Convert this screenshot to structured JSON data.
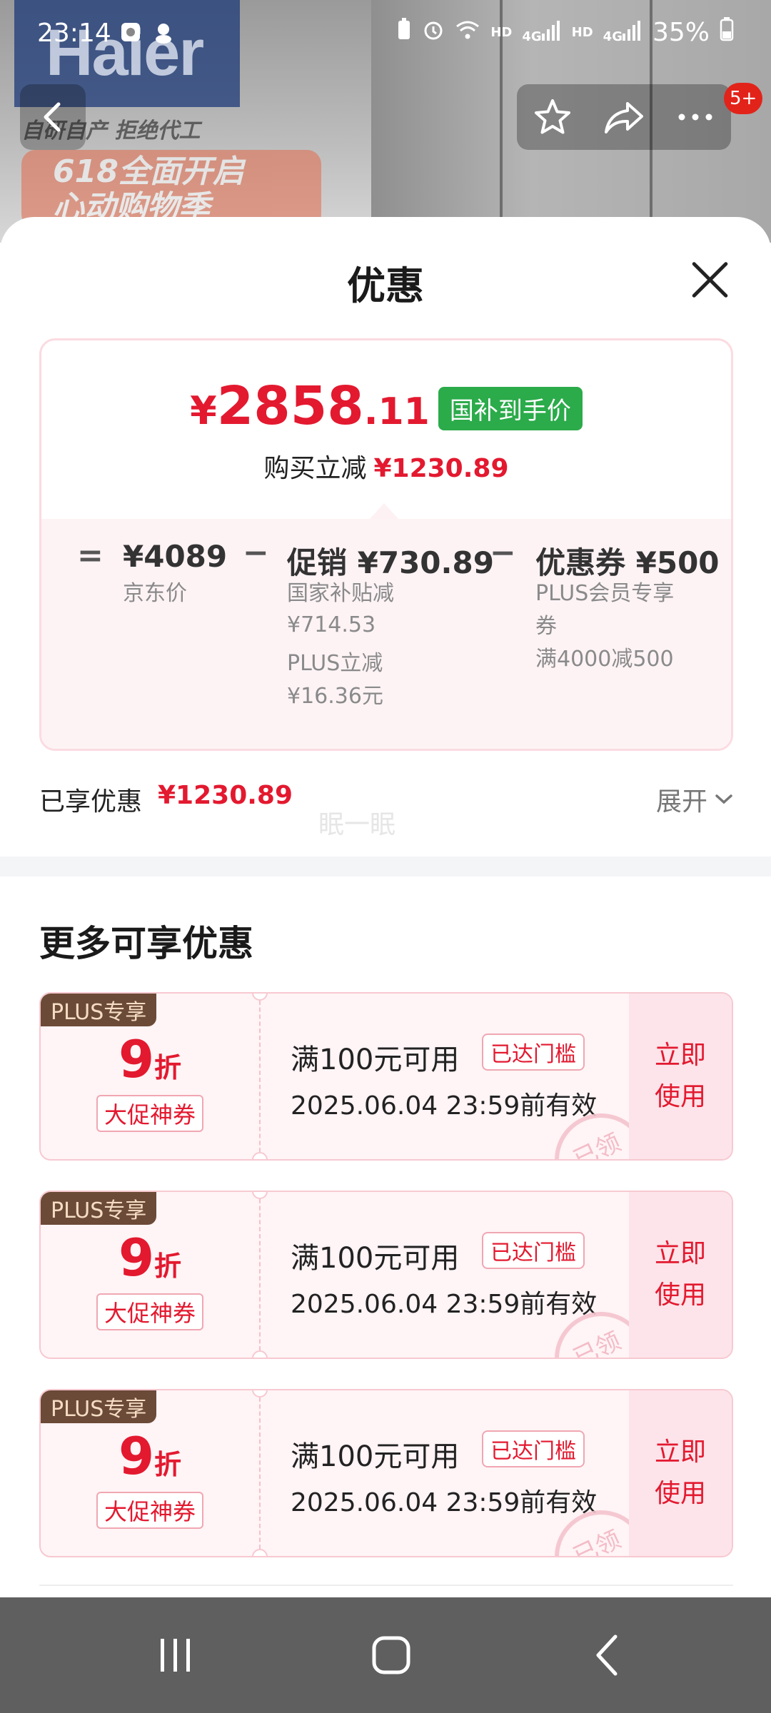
{
  "status_bar": {
    "time": "23:14",
    "battery": "35%",
    "net_labels": [
      "HD",
      "4G",
      "HD",
      "4G"
    ]
  },
  "background": {
    "logo": "Haier",
    "slogan": "自研自产 拒绝代工",
    "promo_line1": "618全面开启",
    "promo_line2": "心动购物季"
  },
  "top_nav": {
    "cart_badge": "5+"
  },
  "sheet": {
    "title": "优惠",
    "final_price": {
      "yen": "¥",
      "integer": "2858",
      "decimal": ".11",
      "tag": "国补到手价",
      "saving_label": "购买立减",
      "saving_amount": "¥1230.89"
    },
    "breakdown": {
      "equals": "=",
      "minus": "−",
      "jd_price": {
        "value": "¥4089",
        "label": "京东价"
      },
      "promo": {
        "value": "促销 ¥730.89",
        "detail1": "国家补贴减",
        "detail1_amt": "¥714.53",
        "detail2": "PLUS立减",
        "detail2_amt": "¥16.36元"
      },
      "coupon": {
        "value": "优惠券 ¥500",
        "detail1": "PLUS会员专享",
        "detail1_cont": "券",
        "detail2": "满4000减500"
      }
    },
    "enjoyed": {
      "label": "已享优惠",
      "amount": "¥1230.89",
      "expand": "展开"
    },
    "watermark": "眠一眠",
    "more_title": "更多可享优惠",
    "coupons": [
      {
        "tag": "PLUS专享",
        "discount": "9",
        "unit": "折",
        "type": "大促神券",
        "condition": "满100元可用",
        "status": "已达门槛",
        "expiry": "2025.06.04 23:59前有效",
        "action1": "立即",
        "action2": "使用",
        "stamp": "已领"
      },
      {
        "tag": "PLUS专享",
        "discount": "9",
        "unit": "折",
        "type": "大促神券",
        "condition": "满100元可用",
        "status": "已达门槛",
        "expiry": "2025.06.04 23:59前有效",
        "action1": "立即",
        "action2": "使用",
        "stamp": "已领"
      },
      {
        "tag": "PLUS专享",
        "discount": "9",
        "unit": "折",
        "type": "大促神券",
        "condition": "满100元可用",
        "status": "已达门槛",
        "expiry": "2025.06.04 23:59前有效",
        "action1": "立即",
        "action2": "使用",
        "stamp": "已领"
      }
    ]
  },
  "colors": {
    "accent_red": "#e3192f",
    "gov_green": "#2bab4a",
    "plus_brown": "#6b4a37",
    "sys_nav": "#5f5f5f"
  }
}
